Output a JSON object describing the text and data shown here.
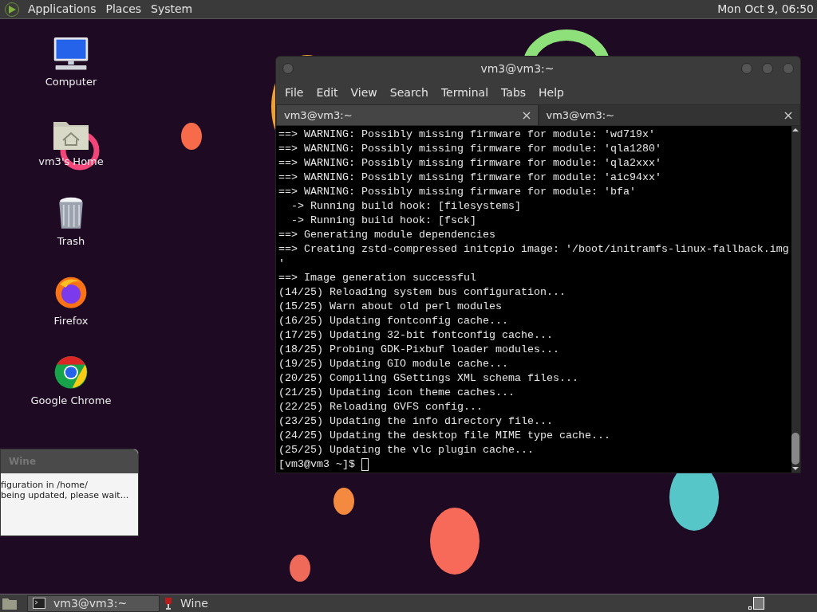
{
  "top_panel": {
    "menus": [
      "Applications",
      "Places",
      "System"
    ],
    "clock": "Mon Oct 9, 06:50"
  },
  "desktop_icons": [
    {
      "label": "Computer",
      "kind": "computer"
    },
    {
      "label": "vm3's Home",
      "kind": "home"
    },
    {
      "label": "Trash",
      "kind": "trash"
    },
    {
      "label": "Firefox",
      "kind": "firefox"
    },
    {
      "label": "Google Chrome",
      "kind": "chrome"
    }
  ],
  "terminal_window": {
    "title": "vm3@vm3:~",
    "menus": [
      "File",
      "Edit",
      "View",
      "Search",
      "Terminal",
      "Tabs",
      "Help"
    ],
    "tabs": [
      {
        "label": "vm3@vm3:~",
        "selected": true
      },
      {
        "label": "vm3@vm3:~",
        "selected": false
      }
    ],
    "lines": [
      "==> WARNING: Possibly missing firmware for module: 'wd719x'",
      "==> WARNING: Possibly missing firmware for module: 'qla1280'",
      "==> WARNING: Possibly missing firmware for module: 'qla2xxx'",
      "==> WARNING: Possibly missing firmware for module: 'aic94xx'",
      "==> WARNING: Possibly missing firmware for module: 'bfa'",
      "  -> Running build hook: [filesystems]",
      "  -> Running build hook: [fsck]",
      "==> Generating module dependencies",
      "==> Creating zstd-compressed initcpio image: '/boot/initramfs-linux-fallback.img",
      "'",
      "==> Image generation successful",
      "(14/25) Reloading system bus configuration...",
      "(15/25) Warn about old perl modules",
      "(16/25) Updating fontconfig cache...",
      "(17/25) Updating 32-bit fontconfig cache...",
      "(18/25) Probing GDK-Pixbuf loader modules...",
      "(19/25) Updating GIO module cache...",
      "(20/25) Compiling GSettings XML schema files...",
      "(21/25) Updating icon theme caches...",
      "(22/25) Reloading GVFS config...",
      "(23/25) Updating the info directory file...",
      "(24/25) Updating the desktop file MIME type cache...",
      "(25/25) Updating the vlc plugin cache..."
    ],
    "prompt": "[vm3@vm3 ~]$"
  },
  "wine_dialog": {
    "title": "Wine",
    "active": false,
    "lines": [
      "figuration in /home/",
      "being updated, please wait..."
    ]
  },
  "taskbar": {
    "tasks": [
      {
        "label": "vm3@vm3:~",
        "kind": "terminal",
        "selected": true
      },
      {
        "label": "Wine",
        "kind": "wine",
        "selected": false
      }
    ]
  }
}
